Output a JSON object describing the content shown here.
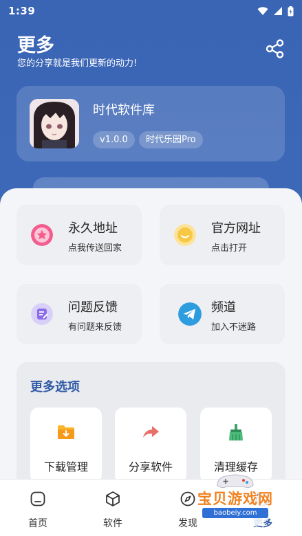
{
  "status_bar": {
    "time": "1:39"
  },
  "header": {
    "title": "更多",
    "subtitle": "您的分享就是我们更新的动力!"
  },
  "profile": {
    "name": "时代软件库",
    "version": "v1.0.0",
    "tag": "时代乐园Pro"
  },
  "links": [
    {
      "title": "永久地址",
      "subtitle": "点我传送回家",
      "icon": "star-icon",
      "color": "#f25d8e"
    },
    {
      "title": "官方网址",
      "subtitle": "点击打开",
      "icon": "smile-icon",
      "color": "#f7c843"
    },
    {
      "title": "问题反馈",
      "subtitle": "有问题来反馈",
      "icon": "feedback-icon",
      "color": "#8a6ee8"
    },
    {
      "title": "频道",
      "subtitle": "加入不迷路",
      "icon": "telegram-icon",
      "color": "#2d9de0"
    }
  ],
  "more_options": {
    "title": "更多选项",
    "items": [
      {
        "label": "下载管理",
        "icon": "download-folder-icon"
      },
      {
        "label": "分享软件",
        "icon": "share-arrow-icon"
      },
      {
        "label": "清理缓存",
        "icon": "broom-icon"
      }
    ]
  },
  "tabs": [
    {
      "label": "首页",
      "icon": "home-icon"
    },
    {
      "label": "软件",
      "icon": "cube-icon"
    },
    {
      "label": "发现",
      "icon": "compass-icon"
    },
    {
      "label": "更多",
      "icon": "more-icon",
      "active": true
    }
  ],
  "watermark": {
    "title": "宝贝游戏网",
    "url": "baobeiy.com"
  },
  "colors": {
    "header": "#3a64b4",
    "accent": "#2f5aa5"
  }
}
